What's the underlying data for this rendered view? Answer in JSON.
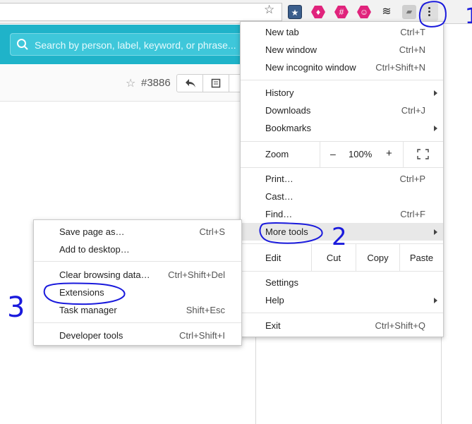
{
  "toolbar": {
    "icons": [
      "star-icon",
      "bookmark-extension-icon",
      "hex-extension-icon",
      "hash-extension-icon",
      "hex-smile-extension-icon",
      "layers-extension-icon",
      "image-extension-icon",
      "chrome-menu-icon"
    ]
  },
  "header": {
    "search_placeholder": "Search by person, label, keyword, or phrase..."
  },
  "subbar": {
    "issue_number": "#3886"
  },
  "main_menu": {
    "new_tab": {
      "label": "New tab",
      "shortcut": "Ctrl+T"
    },
    "new_window": {
      "label": "New window",
      "shortcut": "Ctrl+N"
    },
    "new_incognito": {
      "label": "New incognito window",
      "shortcut": "Ctrl+Shift+N"
    },
    "history": {
      "label": "History"
    },
    "downloads": {
      "label": "Downloads",
      "shortcut": "Ctrl+J"
    },
    "bookmarks": {
      "label": "Bookmarks"
    },
    "zoom": {
      "label": "Zoom",
      "minus": "–",
      "value": "100%",
      "plus": "+"
    },
    "print": {
      "label": "Print…",
      "shortcut": "Ctrl+P"
    },
    "cast": {
      "label": "Cast…"
    },
    "find": {
      "label": "Find…",
      "shortcut": "Ctrl+F"
    },
    "more_tools": {
      "label": "More tools"
    },
    "edit": {
      "label": "Edit",
      "cut": "Cut",
      "copy": "Copy",
      "paste": "Paste"
    },
    "settings": {
      "label": "Settings"
    },
    "help": {
      "label": "Help"
    },
    "exit": {
      "label": "Exit",
      "shortcut": "Ctrl+Shift+Q"
    }
  },
  "sub_menu": {
    "save_page": {
      "label": "Save page as…",
      "shortcut": "Ctrl+S"
    },
    "add_desktop": {
      "label": "Add to desktop…"
    },
    "clear_data": {
      "label": "Clear browsing data…",
      "shortcut": "Ctrl+Shift+Del"
    },
    "extensions": {
      "label": "Extensions"
    },
    "task_manager": {
      "label": "Task manager",
      "shortcut": "Shift+Esc"
    },
    "dev_tools": {
      "label": "Developer tools",
      "shortcut": "Ctrl+Shift+I"
    }
  },
  "annotations": {
    "step1": "1",
    "step2": "2",
    "step3": "3",
    "color": "#1a1adc"
  },
  "colors": {
    "header_teal": "#1fb3c9",
    "menu_highlight": "#e8e8e8"
  }
}
